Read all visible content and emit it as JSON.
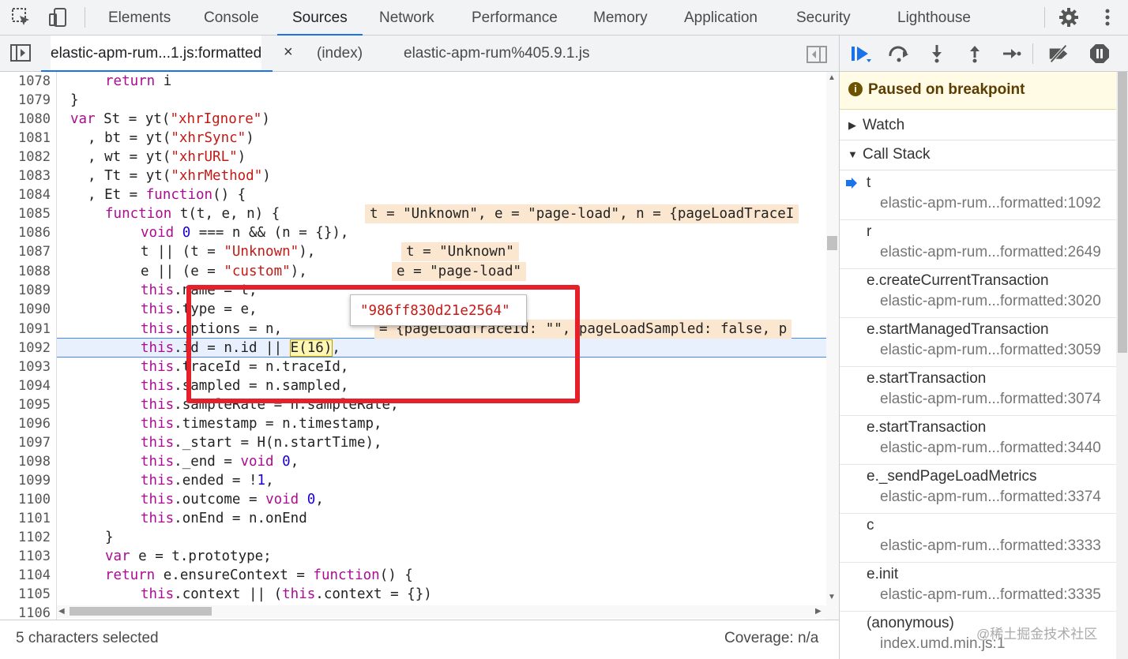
{
  "devtools_tabs": [
    "Elements",
    "Console",
    "Sources",
    "Network",
    "Performance",
    "Memory",
    "Application",
    "Security",
    "Lighthouse"
  ],
  "file_tabs": {
    "active": "elastic-apm-rum...1.js:formatted",
    "close": "×",
    "others": [
      "(index)",
      "elastic-apm-rum%405.9.1.js"
    ]
  },
  "line_numbers": [
    "1078",
    "1079",
    "1080",
    "1081",
    "1082",
    "1083",
    "1084",
    "1085",
    "1086",
    "1087",
    "1088",
    "1089",
    "1090",
    "1091",
    "1092",
    "1093",
    "1094",
    "1095",
    "1096",
    "1097",
    "1098",
    "1099",
    "1100",
    "1101",
    "1102",
    "1103",
    "1104",
    "1105",
    "1106"
  ],
  "inline_values": {
    "l1085": "t = \"Unknown\", e = \"page-load\", n = {pageLoadTraceI",
    "l1087": "t = \"Unknown\"",
    "l1088": "e = \"page-load\"",
    "l1091": "= {pageLoadTraceId: \"\", pageLoadSampled: false, p"
  },
  "tooltip_value": "\"986ff830d21e2564\"",
  "status": {
    "left": "5 characters selected",
    "right": "Coverage: n/a"
  },
  "debugger": {
    "paused_label": "Paused on breakpoint",
    "watch_label": "Watch",
    "callstack_label": "Call Stack",
    "frames": [
      {
        "fn": "t",
        "loc": "elastic-apm-rum...formatted:1092"
      },
      {
        "fn": "r",
        "loc": "elastic-apm-rum...formatted:2649"
      },
      {
        "fn": "e.createCurrentTransaction",
        "loc": "elastic-apm-rum...formatted:3020"
      },
      {
        "fn": "e.startManagedTransaction",
        "loc": "elastic-apm-rum...formatted:3059"
      },
      {
        "fn": "e.startTransaction",
        "loc": "elastic-apm-rum...formatted:3074"
      },
      {
        "fn": "e.startTransaction",
        "loc": "elastic-apm-rum...formatted:3440"
      },
      {
        "fn": "e._sendPageLoadMetrics",
        "loc": "elastic-apm-rum...formatted:3374"
      },
      {
        "fn": "c",
        "loc": "elastic-apm-rum...formatted:3333"
      },
      {
        "fn": "e.init",
        "loc": "elastic-apm-rum...formatted:3335"
      },
      {
        "fn": "(anonymous)",
        "loc": "index.umd.min.js:1"
      }
    ]
  },
  "watermark": "@稀土掘金技术社区",
  "colors": {
    "accent": "#1a73e8",
    "highlight_box": "#e5202b",
    "paused_bg": "#fffbe5"
  }
}
